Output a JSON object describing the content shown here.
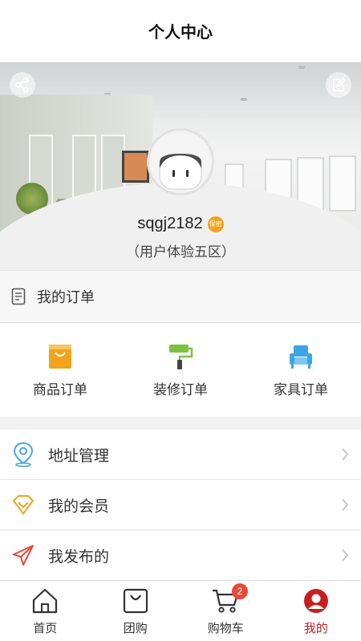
{
  "header": {
    "title": "个人中心"
  },
  "profile": {
    "username": "sqgj2182",
    "badge": "保密",
    "region": "（用户体验五区）"
  },
  "orders": {
    "header_label": "我的订单",
    "items": [
      {
        "label": "商品订单",
        "icon": "shopping-bag-icon",
        "color": "#f2a31c"
      },
      {
        "label": "装修订单",
        "icon": "paint-roller-icon",
        "color": "#7cc242"
      },
      {
        "label": "家具订单",
        "icon": "sofa-icon",
        "color": "#3da5e6"
      }
    ]
  },
  "menu": {
    "items": [
      {
        "label": "地址管理",
        "icon": "location-pin-icon",
        "color": "#4aa8e0"
      },
      {
        "label": "我的会员",
        "icon": "diamond-icon",
        "color": "#f2a31c"
      },
      {
        "label": "我发布的",
        "icon": "paper-plane-icon",
        "color": "#e84a3c"
      }
    ]
  },
  "tabbar": {
    "items": [
      {
        "label": "首页",
        "icon": "home-icon"
      },
      {
        "label": "团购",
        "icon": "bag-icon"
      },
      {
        "label": "购物车",
        "icon": "cart-icon",
        "badge": "2"
      },
      {
        "label": "我的",
        "icon": "user-icon",
        "active": true
      }
    ]
  },
  "colors": {
    "accent": "#c81e1e",
    "background": "#f2f2f2"
  }
}
